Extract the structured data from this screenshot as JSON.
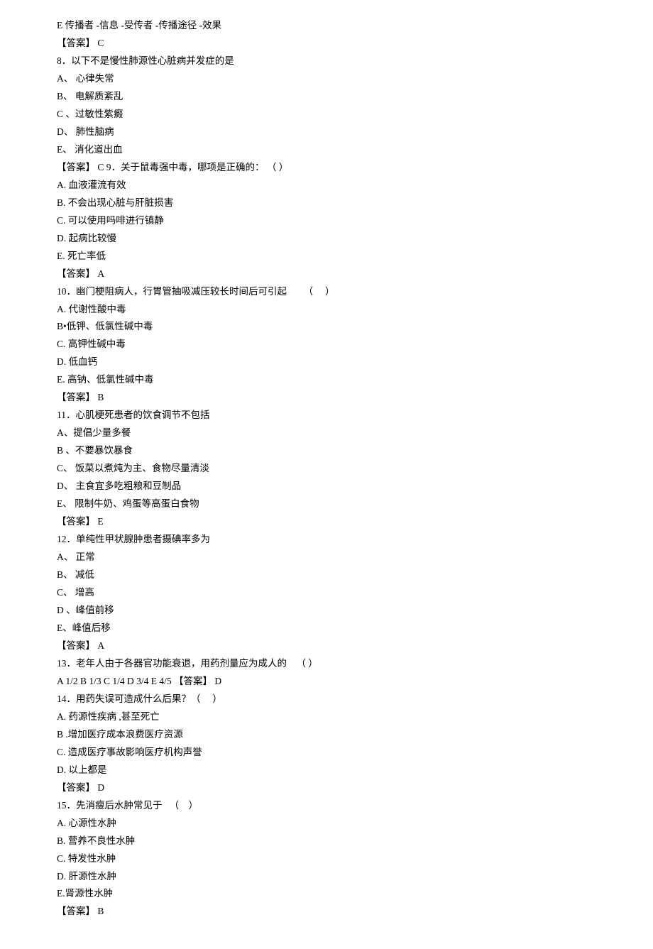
{
  "lines": [
    "E 传播者 -信息 -受传者 -传播途径 -效果",
    "【答案】 C",
    "8．以下不是慢性肺源性心脏病并发症的是",
    "A、 心律失常",
    "B、 电解质紊乱",
    "C 、过敏性紫癜",
    "D、 肺性脑病",
    "E、 消化道出血",
    "【答案】 C 9．关于鼠毒强中毒，哪项是正确的： （ ）",
    "A. 血液灌流有效",
    "B. 不会出现心脏与肝脏损害",
    "C. 可以使用吗啡进行镇静",
    "D. 起病比较慢",
    "E. 死亡率低",
    "【答案】 A",
    "10．幽门梗阻病人，行胃管抽吸减压较长时间后可引起       （     ）",
    "A. 代谢性酸中毒",
    "B•低钾、低氯性碱中毒",
    "C. 高钾性碱中毒",
    "D. 低血钙",
    "E. 高钠、低氯性碱中毒",
    "【答案】 B",
    "11．心肌梗死患者的饮食调节不包括",
    "A、提倡少量多餐",
    "B 、不要暴饮暴食",
    "C、 饭菜以煮炖为主、食物尽量清淡",
    "D、 主食宜多吃粗粮和豆制品",
    "E、 限制牛奶、鸡蛋等高蛋白食物",
    "【答案】 E",
    "12．单纯性甲状腺肿患者摄碘率多为",
    "A、 正常",
    "B、 减低",
    "C、 增高",
    "D 、峰值前移",
    "E、峰值后移",
    "【答案】 A",
    "13．老年人由于各器官功能衰退，用药剂量应为成人的    （ ）",
    "A 1/2 B 1/3 C 1/4 D 3/4 E 4/5 【答案】 D",
    "14．用药失误可造成什么后果？（     ）",
    "A. 药源性疾病 ,甚至死亡",
    "B .增加医疗成本浪费医疗资源",
    "C. 造成医疗事故影响医疗机构声誉",
    "D. 以上都是",
    "【答案】 D",
    "15．先消瘦后水肿常见于   （    ）",
    "A. 心源性水肿",
    "B. 营养不良性水肿",
    "C. 特发性水肿",
    "D. 肝源性水肿",
    "E.肾源性水肿",
    "【答案】 B"
  ]
}
